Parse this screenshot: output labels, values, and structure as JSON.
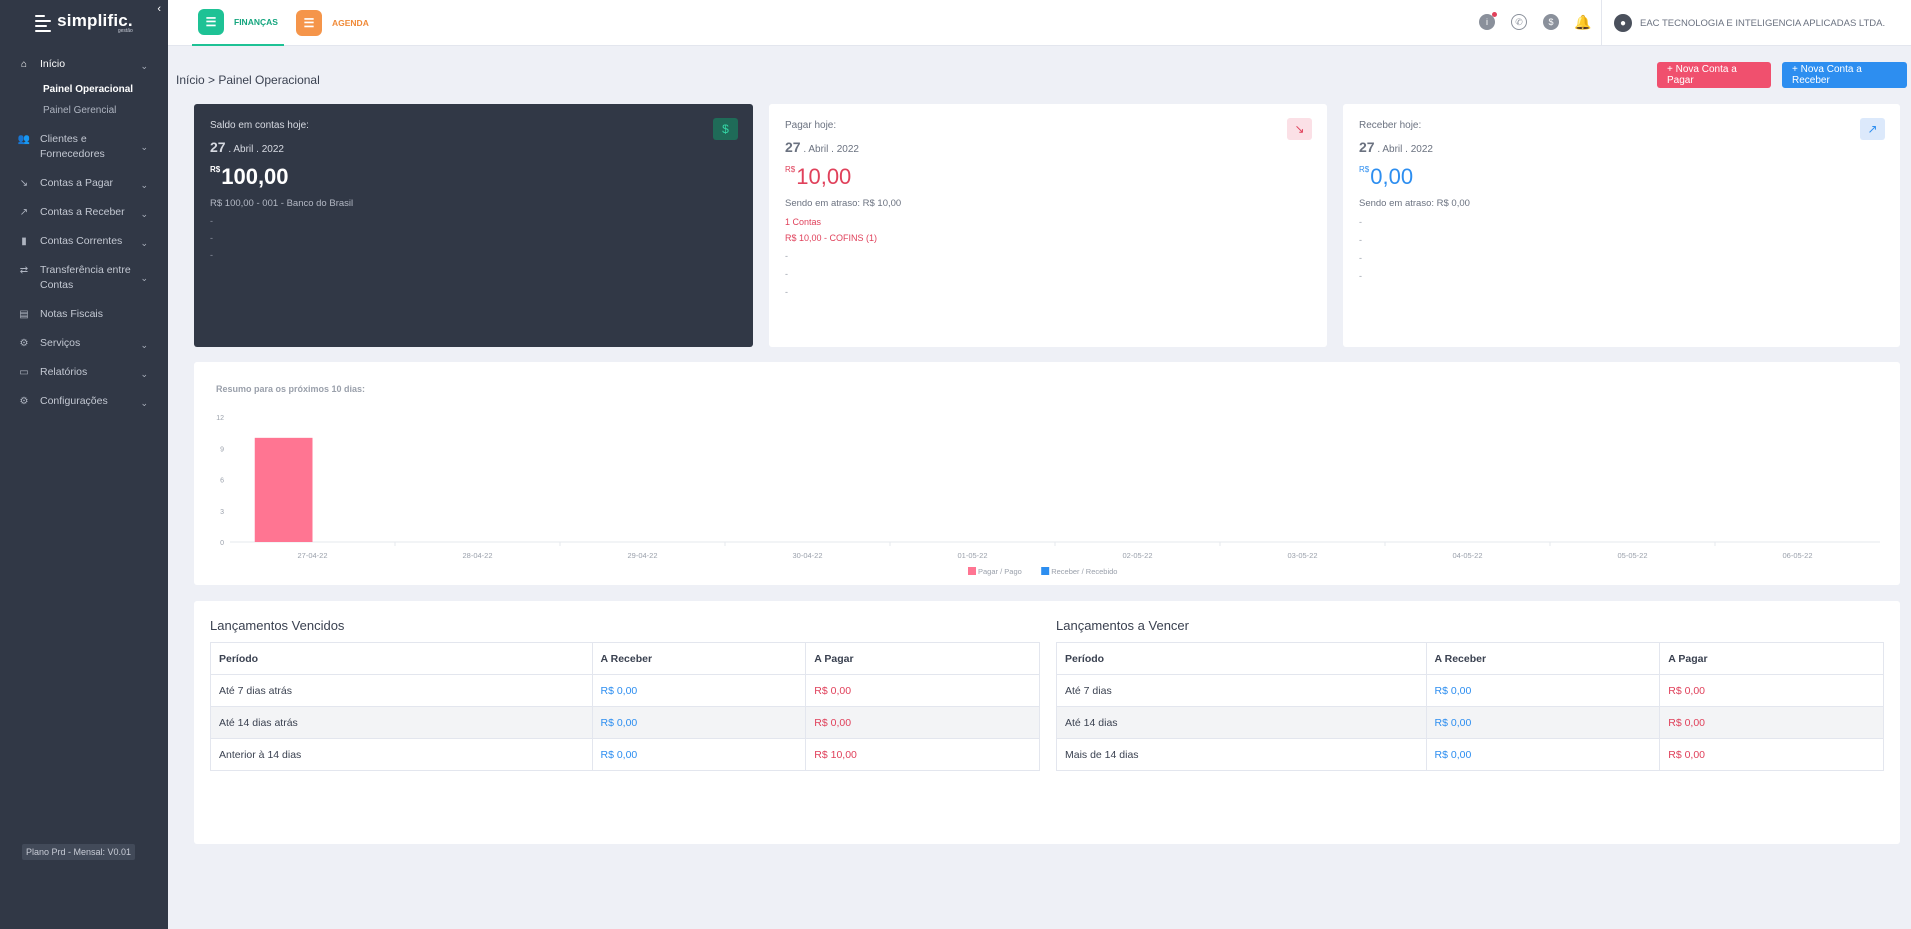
{
  "brand": {
    "name": "simplific.",
    "sub": "gestão"
  },
  "sidebar": {
    "items": [
      {
        "label": "Início",
        "icon": "home-icon",
        "has_chevron": true
      },
      {
        "label": "Clientes e Fornecedores",
        "icon": "users-icon",
        "has_chevron": true
      },
      {
        "label": "Contas a Pagar",
        "icon": "trend-down-icon",
        "has_chevron": true
      },
      {
        "label": "Contas a Receber",
        "icon": "trend-up-icon",
        "has_chevron": true
      },
      {
        "label": "Contas Correntes",
        "icon": "bar-chart-icon",
        "has_chevron": true
      },
      {
        "label": "Transferência entre Contas",
        "icon": "transfer-icon",
        "has_chevron": true
      },
      {
        "label": "Notas Fiscais",
        "icon": "document-icon",
        "has_chevron": false
      },
      {
        "label": "Serviços",
        "icon": "gear-icon",
        "has_chevron": true
      },
      {
        "label": "Relatórios",
        "icon": "report-icon",
        "has_chevron": true
      },
      {
        "label": "Configurações",
        "icon": "settings-icon",
        "has_chevron": true
      }
    ],
    "subitems": [
      {
        "label": "Painel Operacional",
        "active": true
      },
      {
        "label": "Painel Gerencial",
        "active": false
      }
    ],
    "plan": "Plano Prd - Mensal: V0.01"
  },
  "topbar": {
    "tabs": [
      {
        "label": "FINANÇAS",
        "color": "#1ec295"
      },
      {
        "label": "AGENDA",
        "color": "#f5954a"
      }
    ],
    "company": "EAC TECNOLOGIA E INTELIGENCIA APLICADAS LTDA."
  },
  "breadcrumb": "Início > Painel Operacional",
  "actions": {
    "new_payable": "+ Nova Conta a Pagar",
    "new_receivable": "+ Nova Conta a Receber"
  },
  "cards": {
    "balance": {
      "title": "Saldo em contas hoje:",
      "day": "27",
      "month_year": ". Abril . 2022",
      "currency": "R$",
      "amount": "100,00",
      "detail": "R$ 100,00 - 001 - Banco do Brasil",
      "lines": [
        "-",
        "-",
        "-"
      ]
    },
    "pay_today": {
      "title": "Pagar hoje:",
      "day": "27",
      "month_year": ". Abril . 2022",
      "currency": "R$",
      "amount": "10,00",
      "overdue": "Sendo em atraso: R$ 10,00",
      "count": "1 Contas",
      "item": "R$ 10,00 - COFINS (1)",
      "lines": [
        "-",
        "-",
        "-"
      ]
    },
    "receive_today": {
      "title": "Receber hoje:",
      "day": "27",
      "month_year": ". Abril . 2022",
      "currency": "R$",
      "amount": "0,00",
      "overdue": "Sendo em atraso: R$ 0,00",
      "lines": [
        "-",
        "-",
        "-",
        "-"
      ]
    }
  },
  "chart_data": {
    "type": "bar",
    "title": "Resumo para os próximos 10 dias:",
    "categories": [
      "27-04-22",
      "28-04-22",
      "29-04-22",
      "30-04-22",
      "01-05-22",
      "02-05-22",
      "03-05-22",
      "04-05-22",
      "05-05-22",
      "06-05-22"
    ],
    "series": [
      {
        "name": "Pagar / Pago",
        "color": "#ff7592",
        "values": [
          10,
          0,
          0,
          0,
          0,
          0,
          0,
          0,
          0,
          0
        ]
      },
      {
        "name": "Receber / Recebido",
        "color": "#2d8ef0",
        "values": [
          0,
          0,
          0,
          0,
          0,
          0,
          0,
          0,
          0,
          0
        ]
      }
    ],
    "yticks": [
      0,
      3,
      6,
      9,
      12
    ],
    "ylim": [
      0,
      12
    ],
    "legend": "bottom-center"
  },
  "overdue_table": {
    "title": "Lançamentos Vencidos",
    "headers": [
      "Período",
      "A Receber",
      "A Pagar"
    ],
    "rows": [
      [
        "Até 7 dias atrás",
        "R$ 0,00",
        "R$ 0,00"
      ],
      [
        "Até 14 dias atrás",
        "R$ 0,00",
        "R$ 0,00"
      ],
      [
        "Anterior à 14 dias",
        "R$ 0,00",
        "R$ 10,00"
      ]
    ]
  },
  "upcoming_table": {
    "title": "Lançamentos a Vencer",
    "headers": [
      "Período",
      "A Receber",
      "A Pagar"
    ],
    "rows": [
      [
        "Até 7 dias",
        "R$ 0,00",
        "R$ 0,00"
      ],
      [
        "Até 14 dias",
        "R$ 0,00",
        "R$ 0,00"
      ],
      [
        "Mais de 14 dias",
        "R$ 0,00",
        "R$ 0,00"
      ]
    ]
  }
}
